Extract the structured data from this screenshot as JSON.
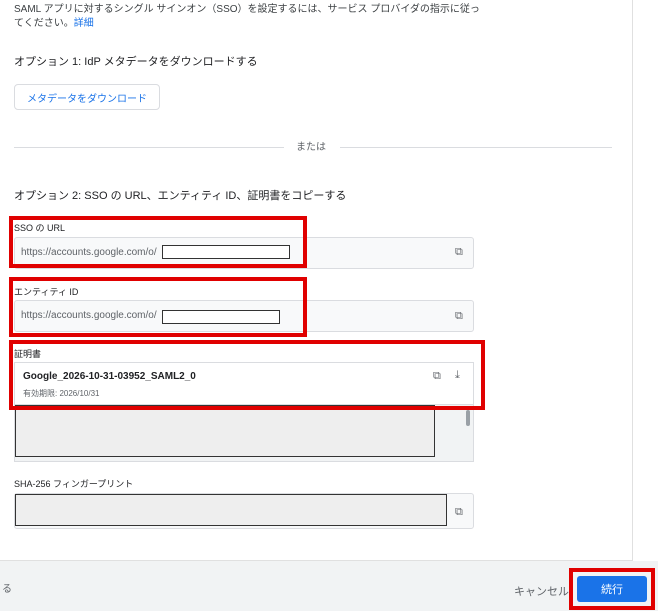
{
  "intro": {
    "line1": "SAML アプリに対するシングル サインオン（SSO）を設定するには、サービス プロバイダの指示に従っ",
    "line2": "てください。",
    "details_link": "詳細"
  },
  "option1": {
    "title": "オプション 1: IdP メタデータをダウンロードする",
    "download_button": "メタデータをダウンロード"
  },
  "divider_label": "または",
  "option2": {
    "title": "オプション 2: SSO の URL、エンティティ ID、証明書をコピーする",
    "sso_url": {
      "label": "SSO の URL",
      "value": "https://accounts.google.com/o/"
    },
    "entity_id": {
      "label": "エンティティ ID",
      "value": "https://accounts.google.com/o/"
    },
    "certificate": {
      "label": "証明書",
      "name": "Google_2026-10-31-03952_SAML2_0",
      "expiry": "有効期限: 2026/10/31"
    },
    "sha256": {
      "label": "SHA-256 フィンガープリント"
    }
  },
  "footer": {
    "back_label": "る",
    "cancel_label": "キャンセル",
    "continue_label": "続行"
  },
  "colors": {
    "accent": "#1a73e8",
    "highlight": "#e00000"
  }
}
